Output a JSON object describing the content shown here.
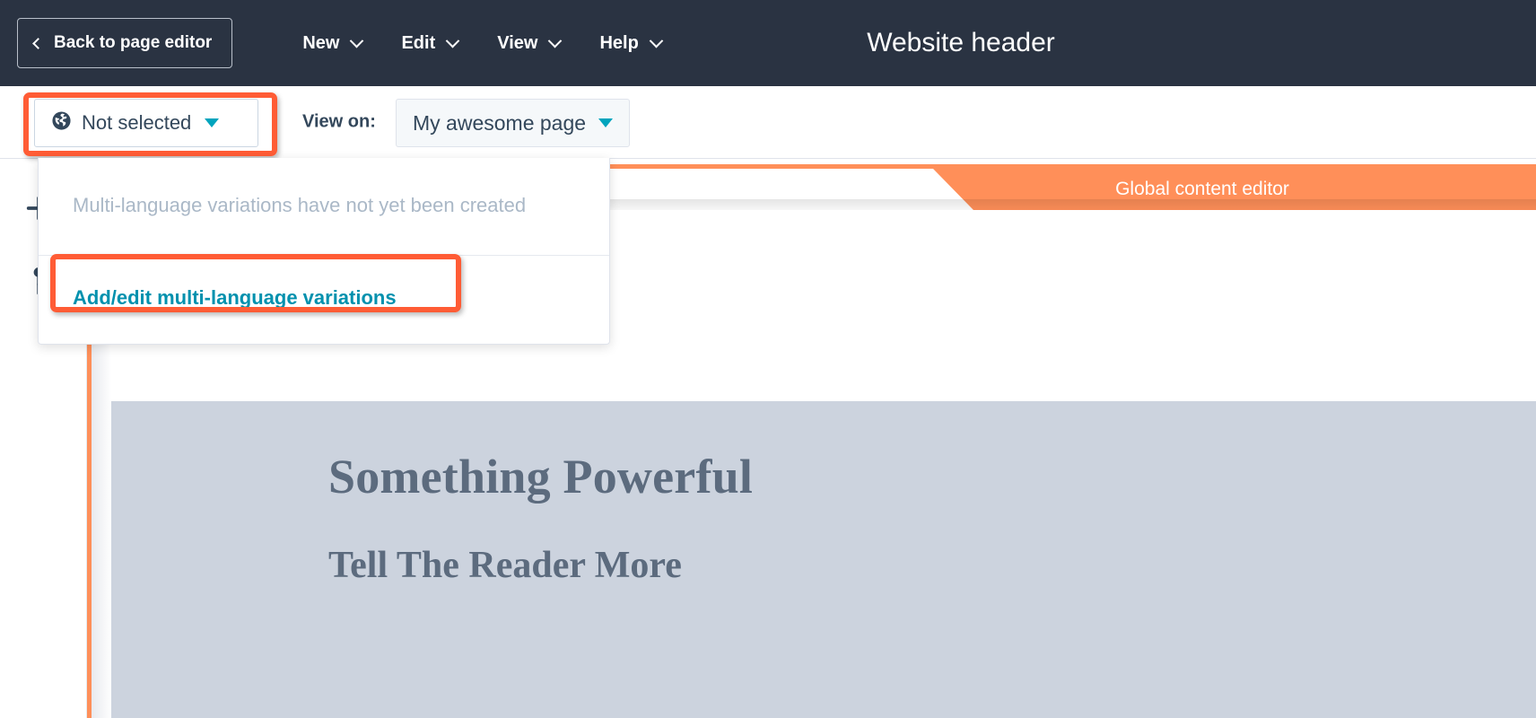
{
  "topbar": {
    "back_button": "Back to page editor",
    "back_icon": "chevron-left-icon",
    "menus": [
      {
        "label": "New",
        "icon": "chevron-down-icon"
      },
      {
        "label": "Edit",
        "icon": "chevron-down-icon"
      },
      {
        "label": "View",
        "icon": "chevron-down-icon"
      },
      {
        "label": "Help",
        "icon": "chevron-down-icon"
      }
    ],
    "title": "Website header",
    "background_color": "#2a3342"
  },
  "toolbar": {
    "language_select": {
      "icon": "globe-icon",
      "value": "Not selected",
      "caret_icon": "caret-down-icon",
      "caret_color": "#00a4bd"
    },
    "view_on_label": "View on:",
    "page_select": {
      "value": "My awesome page",
      "caret_icon": "caret-down-icon"
    },
    "device_toggle": {
      "desktop": {
        "icon": "desktop-icon",
        "active": true
      },
      "mobile": {
        "icon": "mobile-icon",
        "active": false
      }
    }
  },
  "dropdown": {
    "empty_message": "Multi-language variations have not yet been created",
    "action_link": "Add/edit multi-language variations",
    "action_link_color": "#0091ae"
  },
  "highlights": {
    "color": "#ff5c35",
    "targets": [
      "language-select",
      "add-edit-multi-language-link"
    ]
  },
  "sidebar": {
    "icons": [
      {
        "name": "add-module-icon"
      },
      {
        "name": "settings-icon"
      }
    ]
  },
  "banner": {
    "label": "Global content editor",
    "color": "#ff8f59"
  },
  "preview": {
    "heading": "Something Powerful",
    "subheading": "Tell The Reader More",
    "hero_background": "#ccd3de",
    "text_color": "#5c6b7e"
  }
}
